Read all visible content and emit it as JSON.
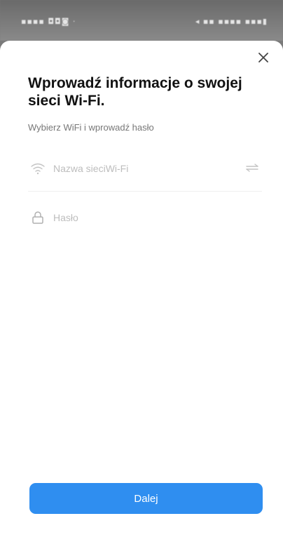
{
  "status_bar": {
    "left_text": "▪▪▪▪ ◘◘◙ ·",
    "right_text": "◂ ▪▪ ▪▪▪▪  ▪▪▪▮"
  },
  "dialog": {
    "title": "Wprowadź informacje o swojej sieci Wi-Fi.",
    "subtitle": "Wybierz WiFi i wprowadź hasło"
  },
  "wifi_field": {
    "placeholder": "Nazwa sieciWi-Fi",
    "icon": "wifi-icon",
    "right_icon": "wifi-list-icon"
  },
  "password_field": {
    "placeholder": "Hasło",
    "icon": "lock-icon"
  },
  "footer": {
    "next_label": "Dalej"
  },
  "colors": {
    "accent": "#2f8ef0",
    "title": "#111111",
    "placeholder": "#bdbdbd"
  }
}
